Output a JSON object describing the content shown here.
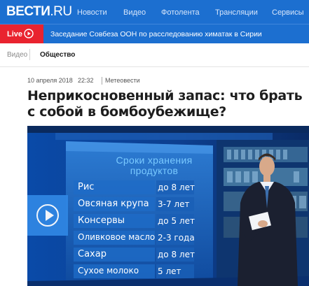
{
  "header": {
    "logo_main": "ВЕСТИ",
    "logo_suffix": ".RU",
    "nav": [
      "Новости",
      "Видео",
      "Фотолента",
      "Трансляции",
      "Сервисы"
    ]
  },
  "live": {
    "badge": "Live",
    "headline": "Заседание Совбеза ООН по расследованию химатак в Сирии"
  },
  "breadcrumb": [
    "Видео",
    "Общество"
  ],
  "article": {
    "date": "10 апреля 2018",
    "time": "22:32",
    "category": "Метеовести",
    "title": "Неприкосновенный запас: что брать с собой в бомбоубежище?"
  },
  "video": {
    "panel_title_1": "Сроки хранения",
    "panel_title_2": "продуктов",
    "items": [
      {
        "name": "Рис",
        "shelf": "до 8 лет"
      },
      {
        "name": "Овсяная крупа",
        "shelf": "3-7 лет"
      },
      {
        "name": "Консервы",
        "shelf": "до 5 лет"
      },
      {
        "name": "Оливковое масло",
        "shelf": "2-3 года"
      },
      {
        "name": "Сахар",
        "shelf": "до 8 лет"
      },
      {
        "name": "Сухое молоко",
        "shelf": "5 лет"
      }
    ]
  },
  "colors": {
    "brand_blue": "#1c6fd0",
    "live_red": "#e9232f",
    "play_blue": "#2f86e3"
  }
}
